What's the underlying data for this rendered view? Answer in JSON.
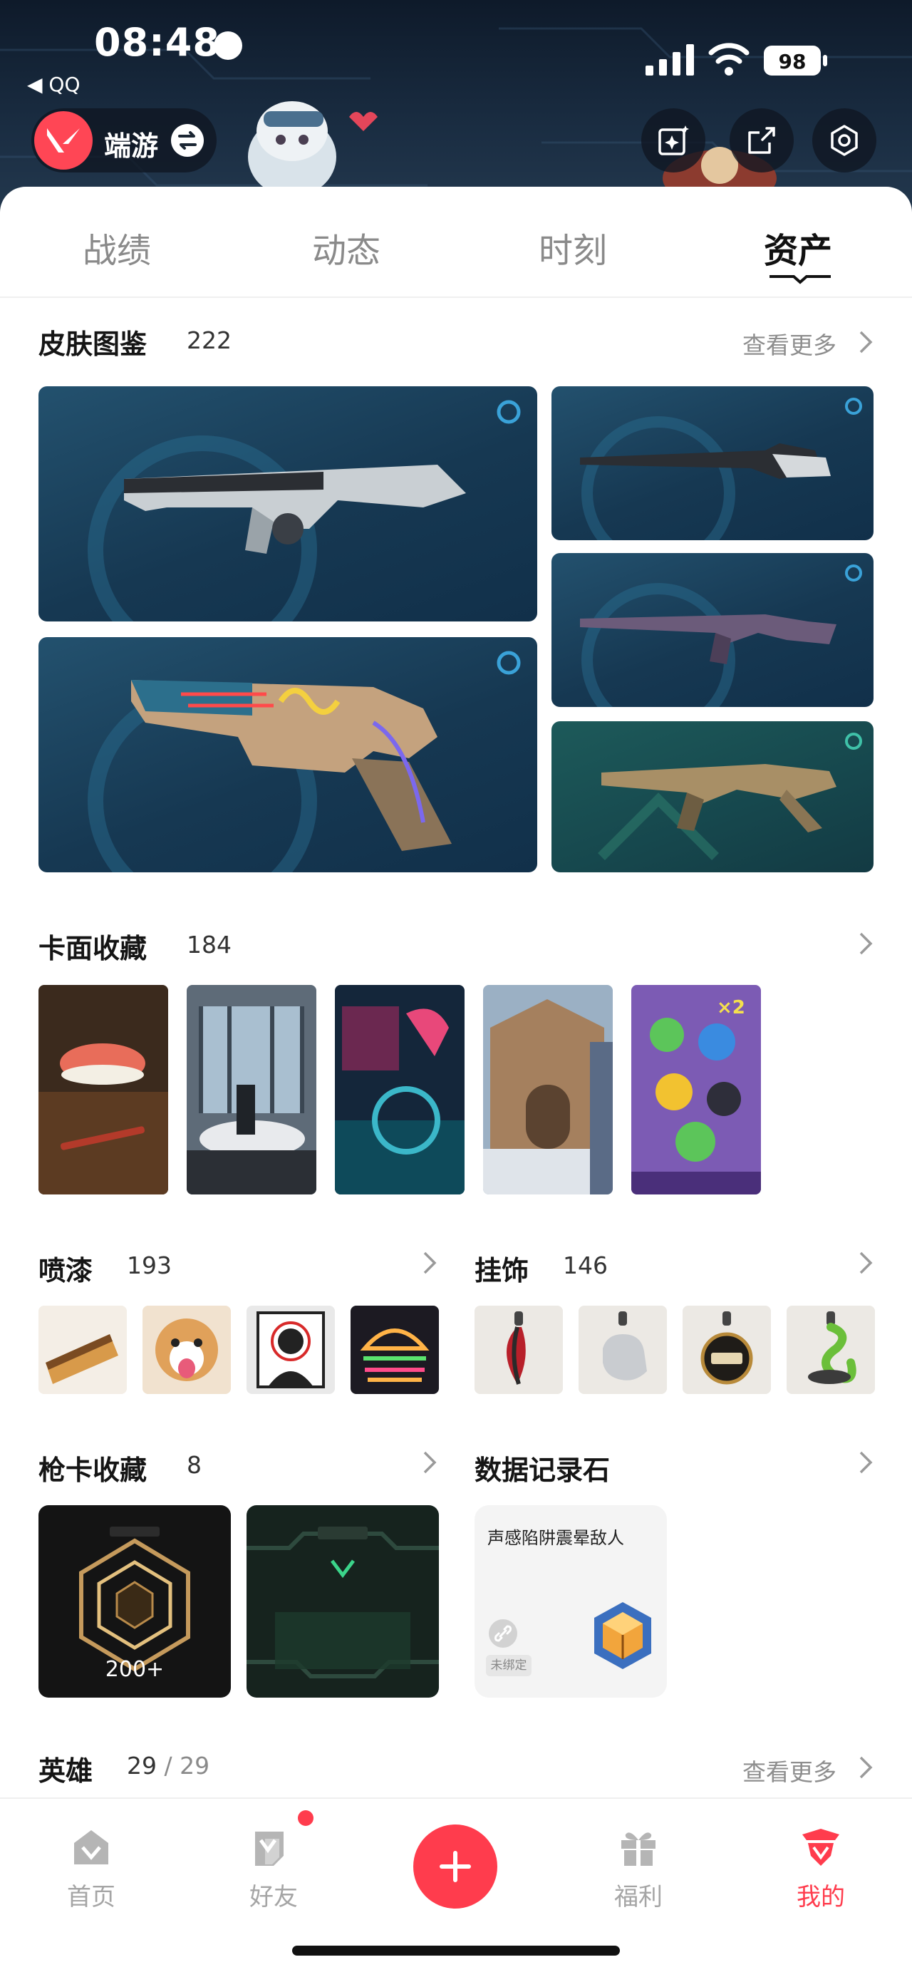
{
  "status_bar": {
    "time": "08:48",
    "back_app": "◀ QQ",
    "battery": "98"
  },
  "header": {
    "game_label": "端游"
  },
  "tabs": [
    {
      "label": "战绩",
      "active": false
    },
    {
      "label": "动态",
      "active": false
    },
    {
      "label": "时刻",
      "active": false
    },
    {
      "label": "资产",
      "active": true
    }
  ],
  "skins": {
    "title": "皮肤图鉴",
    "count": "222",
    "more": "查看更多"
  },
  "cards": {
    "title": "卡面收藏",
    "count": "184"
  },
  "sprays": {
    "title": "喷漆",
    "count": "193"
  },
  "buddies": {
    "title": "挂饰",
    "count": "146"
  },
  "gun_cards": {
    "title": "枪卡收藏",
    "count": "8",
    "items": [
      {
        "count": "200+"
      },
      {
        "count": ""
      }
    ]
  },
  "data_stone": {
    "title": "数据记录石",
    "name": "声感陷阱震晕敌人",
    "tag": "未绑定"
  },
  "heroes": {
    "title": "英雄",
    "owned": "29",
    "separator": "/",
    "total": "29",
    "more": "查看更多"
  },
  "bottom_nav": [
    {
      "label": "首页",
      "icon": "home-icon",
      "active": false
    },
    {
      "label": "好友",
      "icon": "friends-icon",
      "active": false,
      "badge": true
    },
    {
      "label": "",
      "icon": "plus-icon",
      "active": false
    },
    {
      "label": "福利",
      "icon": "gift-icon",
      "active": false
    },
    {
      "label": "我的",
      "icon": "profile-icon",
      "active": true
    }
  ],
  "colors": {
    "accent": "#ff3c4d",
    "tile_blue": "#163852",
    "tile_green": "#16474d"
  }
}
